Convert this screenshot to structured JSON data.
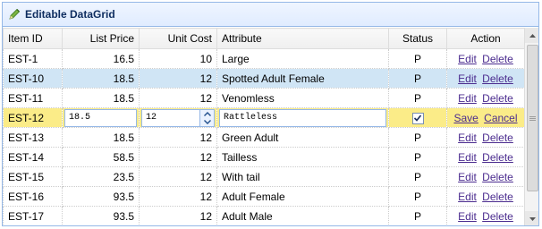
{
  "panel": {
    "title": "Editable DataGrid",
    "icon": "pencil-icon"
  },
  "columns": {
    "item_id": "Item ID",
    "list_price": "List Price",
    "unit_cost": "Unit Cost",
    "attribute": "Attribute",
    "status": "Status",
    "action": "Action"
  },
  "rows": [
    {
      "item_id": "EST-1",
      "list_price": "16.5",
      "unit_cost": "10",
      "attribute": "Large",
      "status": "P",
      "edit": "Edit",
      "delete": "Delete"
    },
    {
      "item_id": "EST-10",
      "list_price": "18.5",
      "unit_cost": "12",
      "attribute": "Spotted Adult Female",
      "status": "P",
      "edit": "Edit",
      "delete": "Delete"
    },
    {
      "item_id": "EST-11",
      "list_price": "18.5",
      "unit_cost": "12",
      "attribute": "Venomless",
      "status": "P",
      "edit": "Edit",
      "delete": "Delete"
    },
    {
      "item_id": "EST-12",
      "list_price": "18.5",
      "unit_cost": "12",
      "attribute": "Rattleless",
      "status": "checked",
      "save": "Save",
      "cancel": "Cancel"
    },
    {
      "item_id": "EST-13",
      "list_price": "18.5",
      "unit_cost": "12",
      "attribute": "Green Adult",
      "status": "P",
      "edit": "Edit",
      "delete": "Delete"
    },
    {
      "item_id": "EST-14",
      "list_price": "58.5",
      "unit_cost": "12",
      "attribute": "Tailless",
      "status": "P",
      "edit": "Edit",
      "delete": "Delete"
    },
    {
      "item_id": "EST-15",
      "list_price": "23.5",
      "unit_cost": "12",
      "attribute": "With tail",
      "status": "P",
      "edit": "Edit",
      "delete": "Delete"
    },
    {
      "item_id": "EST-16",
      "list_price": "93.5",
      "unit_cost": "12",
      "attribute": "Adult Female",
      "status": "P",
      "edit": "Edit",
      "delete": "Delete"
    },
    {
      "item_id": "EST-17",
      "list_price": "93.5",
      "unit_cost": "12",
      "attribute": "Adult Male",
      "status": "P",
      "edit": "Edit",
      "delete": "Delete"
    }
  ],
  "colors": {
    "header_border": "#95b8e7",
    "selected_row": "#d0e5f5",
    "editing_row": "#fbec88",
    "link": "#4b2c8f"
  }
}
